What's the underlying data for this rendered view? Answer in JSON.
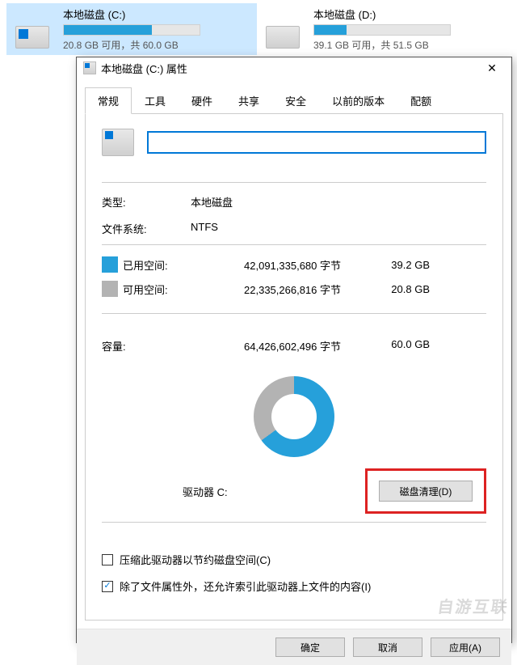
{
  "drives": [
    {
      "label": "本地磁盘 (C:)",
      "status": "20.8 GB 可用，共 60.0 GB",
      "fill_pct": 65,
      "selected": true,
      "has_winlogo": true
    },
    {
      "label": "本地磁盘 (D:)",
      "status": "39.1 GB 可用，共 51.5 GB",
      "fill_pct": 24,
      "selected": false,
      "has_winlogo": false
    }
  ],
  "dialog": {
    "title": "本地磁盘 (C:) 属性",
    "close_glyph": "✕",
    "tabs": [
      "常规",
      "工具",
      "硬件",
      "共享",
      "安全",
      "以前的版本",
      "配额"
    ],
    "active_tab": 0,
    "name_value": "",
    "type_label": "类型:",
    "type_value": "本地磁盘",
    "fs_label": "文件系统:",
    "fs_value": "NTFS",
    "used_label": "已用空间:",
    "used_bytes": "42,091,335,680 字节",
    "used_gb": "39.2 GB",
    "free_label": "可用空间:",
    "free_bytes": "22,335,266,816 字节",
    "free_gb": "20.8 GB",
    "cap_label": "容量:",
    "cap_bytes": "64,426,602,496 字节",
    "cap_gb": "60.0 GB",
    "drive_letter_label": "驱动器 C:",
    "cleanup_btn": "磁盘清理(D)",
    "compress_check": "压缩此驱动器以节约磁盘空间(C)",
    "compress_checked": false,
    "index_check": "除了文件属性外，还允许索引此驱动器上文件的内容(I)",
    "index_checked": true,
    "ok_btn": "确定",
    "cancel_btn": "取消",
    "apply_btn": "应用(A)"
  },
  "watermark": "自游互联",
  "chart_data": {
    "type": "pie",
    "title": "驱动器 C:",
    "series": [
      {
        "name": "已用空间",
        "value": 39.2,
        "unit": "GB",
        "bytes": 42091335680,
        "color": "#26a0da"
      },
      {
        "name": "可用空间",
        "value": 20.8,
        "unit": "GB",
        "bytes": 22335266816,
        "color": "#b3b3b3"
      }
    ],
    "total": {
      "label": "容量",
      "value": 60.0,
      "unit": "GB",
      "bytes": 64426602496
    }
  }
}
